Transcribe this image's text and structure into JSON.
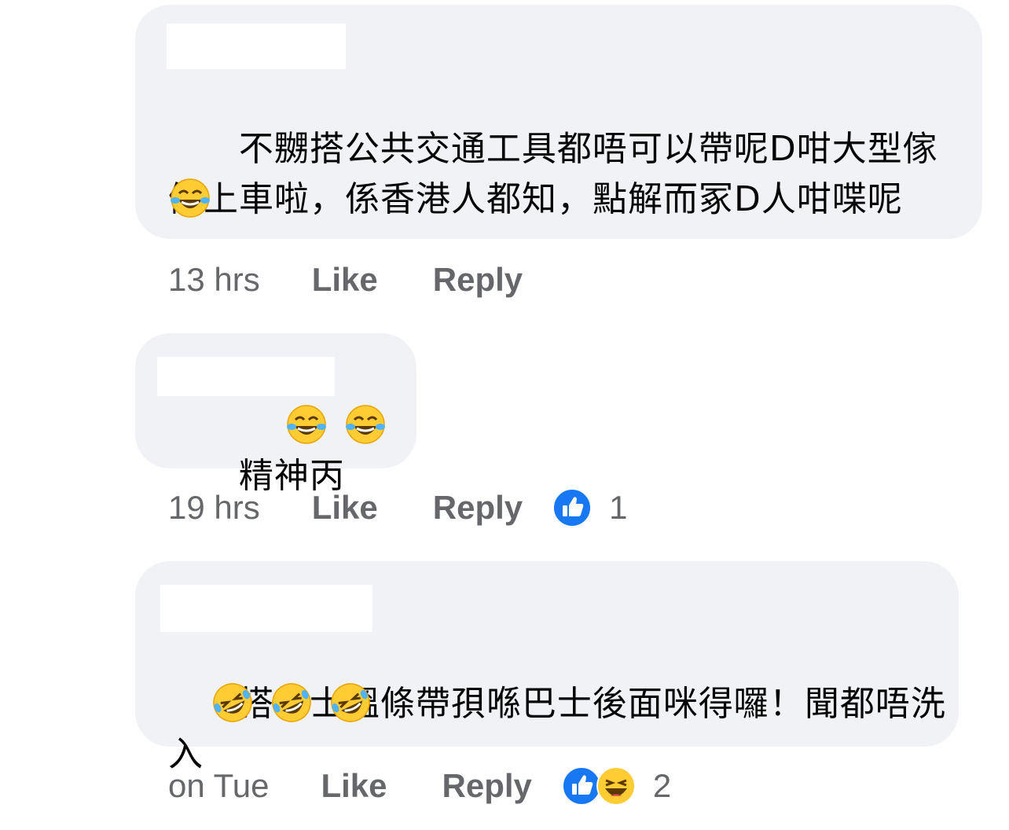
{
  "comments": [
    {
      "text": "不嬲搭公共交通工具都唔可以帶呢D咁大型傢俬上車啦，係香港人都知，點解而冢D人咁喋呢",
      "emojis": [
        "joy-icon"
      ],
      "time": "13 hrs",
      "like_label": "Like",
      "reply_label": "Reply",
      "reactions": [],
      "reaction_count": ""
    },
    {
      "text": "精神丙",
      "emojis": [
        "joy-icon",
        "joy-icon"
      ],
      "time": "19 hrs",
      "like_label": "Like",
      "reply_label": "Reply",
      "reactions": [
        "like-reaction-icon"
      ],
      "reaction_count": "1"
    },
    {
      "text": "搭巴士搵條帶孭喺巴士後面咪得囉！聞都唔洗入",
      "emojis": [
        "rofl-icon",
        "rofl-icon",
        "rofl-icon"
      ],
      "time": "on Tue",
      "like_label": "Like",
      "reply_label": "Reply",
      "reactions": [
        "like-reaction-icon",
        "haha-reaction-icon"
      ],
      "reaction_count": "2"
    }
  ],
  "colors": {
    "bubble": "#f0f2f5",
    "meta_text": "#65676b",
    "like_blue": "#1877f2",
    "emoji_yellow": "#ffcc33"
  }
}
